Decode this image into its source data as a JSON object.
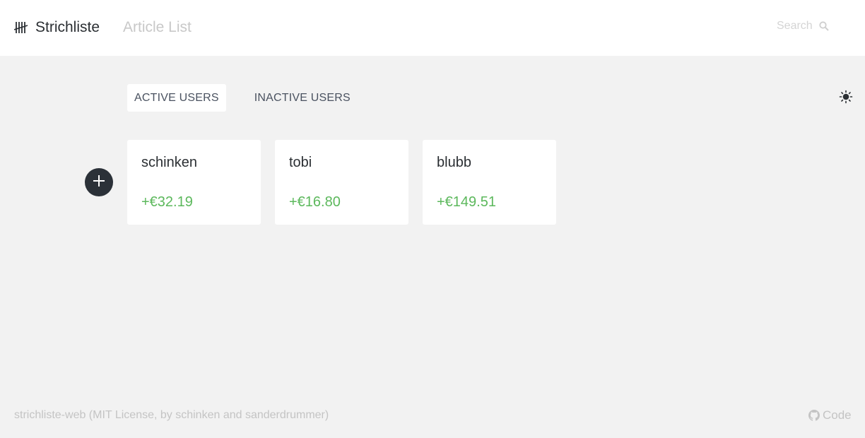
{
  "header": {
    "brand_label": "Strichliste",
    "brand_icon": "tally-marks-icon",
    "nav_article_list": "Article List",
    "search_placeholder": "Search",
    "search_icon": "search-icon"
  },
  "tabs": [
    {
      "label": "ACTIVE USERS",
      "active": true
    },
    {
      "label": "INACTIVE USERS",
      "active": false
    }
  ],
  "theme_toggle_icon": "sun-icon",
  "add_user_icon": "plus-icon",
  "users": [
    {
      "name": "schinken",
      "balance": "+€32.19"
    },
    {
      "name": "tobi",
      "balance": "+€16.80"
    },
    {
      "name": "blubb",
      "balance": "+€149.51"
    }
  ],
  "footer": {
    "text": "strichliste-web (MIT License, by schinken and sanderdrummer)",
    "code_label": "Code",
    "code_icon": "github-icon"
  },
  "colors": {
    "positive_balance": "#5cb85c",
    "header_bg": "#ffffff",
    "page_bg": "#f2f2f2",
    "add_button_bg": "#2b3138"
  }
}
